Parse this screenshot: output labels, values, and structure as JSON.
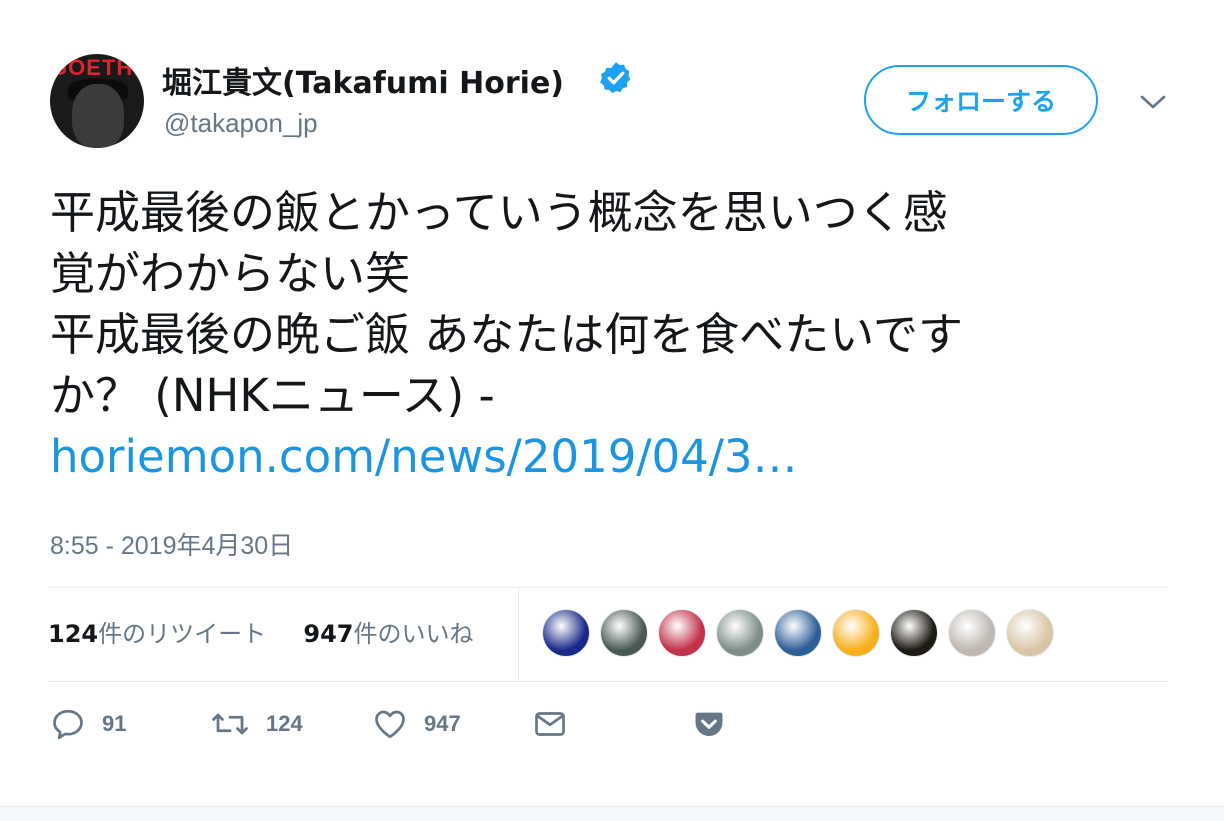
{
  "author": {
    "name": "堀江貴文(Takafumi Horie)",
    "handle": "@takapon_jp",
    "avatar_text": "GOETHE"
  },
  "follow_button": {
    "label": "フォローする"
  },
  "tweet": {
    "lines": [
      "平成最後の飯とかっていう概念を思いつく感",
      "覚がわからない笑",
      "平成最後の晩ご飯 あなたは何を食べたいです",
      "か？ (NHKニュース) -"
    ],
    "link": "horiemon.com/news/2019/04/3…"
  },
  "timestamp": "8:55 - 2019年4月30日",
  "stats": {
    "retweets_count": "124",
    "retweets_label": "件のリツイート",
    "likes_count": "947",
    "likes_label": "件のいいね"
  },
  "likers": [
    {
      "icon": "fireworks-avatar",
      "color": "#1b2a8a"
    },
    {
      "icon": "waterfall-avatar",
      "color": "#4a5a52"
    },
    {
      "icon": "phone-avatar",
      "color": "#c2324a"
    },
    {
      "icon": "temple-avatar",
      "color": "#7e8f8a"
    },
    {
      "icon": "sky-avatar",
      "color": "#2f5f98"
    },
    {
      "icon": "cartoon-avatar",
      "color": "#f6b01c"
    },
    {
      "icon": "food-avatar",
      "color": "#1e1a14"
    },
    {
      "icon": "man-avatar",
      "color": "#bfb8b2"
    },
    {
      "icon": "cat-avatar",
      "color": "#d9c4a6"
    }
  ],
  "actions": {
    "reply_count": "91",
    "retweet_count": "124",
    "like_count": "947"
  },
  "colors": {
    "accent": "#1da1f2",
    "link": "#1b95e0",
    "muted": "#657786",
    "text": "#14171a"
  }
}
